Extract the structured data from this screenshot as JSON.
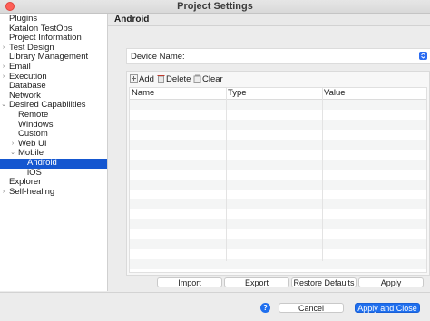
{
  "window": {
    "title": "Project Settings"
  },
  "sidebar": {
    "items": [
      {
        "label": "Plugins",
        "arrow": "",
        "indent": 0
      },
      {
        "label": "Katalon TestOps",
        "arrow": "",
        "indent": 0
      },
      {
        "label": "Project Information",
        "arrow": "",
        "indent": 0
      },
      {
        "label": "Test Design",
        "arrow": "›",
        "indent": 0
      },
      {
        "label": "Library Management",
        "arrow": "",
        "indent": 0
      },
      {
        "label": "Email",
        "arrow": "›",
        "indent": 0
      },
      {
        "label": "Execution",
        "arrow": "›",
        "indent": 0
      },
      {
        "label": "Database",
        "arrow": "",
        "indent": 0
      },
      {
        "label": "Network",
        "arrow": "",
        "indent": 0
      },
      {
        "label": "Desired Capabilities",
        "arrow": "⌄",
        "indent": 0
      },
      {
        "label": "Remote",
        "arrow": "",
        "indent": 1
      },
      {
        "label": "Windows",
        "arrow": "",
        "indent": 1
      },
      {
        "label": "Custom",
        "arrow": "",
        "indent": 1
      },
      {
        "label": "Web UI",
        "arrow": "›",
        "indent": 1
      },
      {
        "label": "Mobile",
        "arrow": "⌄",
        "indent": 1
      },
      {
        "label": "Android",
        "arrow": "",
        "indent": 2,
        "selected": true
      },
      {
        "label": "iOS",
        "arrow": "",
        "indent": 2
      },
      {
        "label": "Explorer",
        "arrow": "",
        "indent": 0
      },
      {
        "label": "Self-healing",
        "arrow": "›",
        "indent": 0
      }
    ]
  },
  "page": {
    "title": "Android",
    "device_label": "Device Name:",
    "device_value": ""
  },
  "toolbar": {
    "add_label": "Add",
    "delete_label": "Delete",
    "clear_label": "Clear"
  },
  "table": {
    "columns": [
      "Name",
      "Type",
      "Value"
    ],
    "rows": []
  },
  "actions": {
    "import_label": "Import",
    "export_label": "Export",
    "restore_label": "Restore Defaults",
    "apply_label": "Apply"
  },
  "footer": {
    "help_label": "?",
    "cancel_label": "Cancel",
    "apply_close_label": "Apply and Close"
  },
  "colors": {
    "accent": "#1f6fee",
    "selection": "#1557d0"
  },
  "icons": {
    "add": "add-icon",
    "delete": "trash-icon",
    "clear": "clear-icon",
    "help": "help-icon",
    "dropdown": "chevron-updown-icon"
  }
}
